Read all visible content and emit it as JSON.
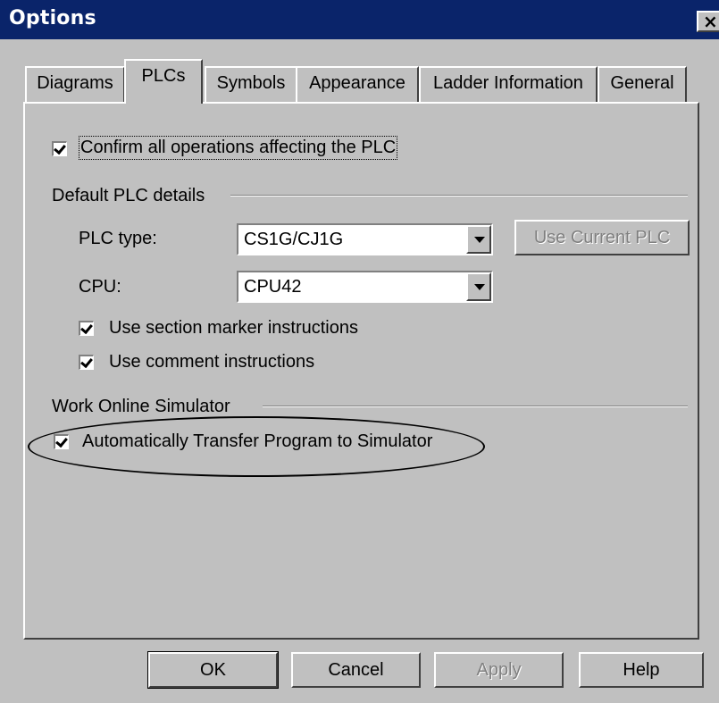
{
  "window": {
    "title": "Options",
    "close_glyph": "×"
  },
  "tabs": [
    {
      "label": "Diagrams"
    },
    {
      "label": "PLCs"
    },
    {
      "label": "Symbols"
    },
    {
      "label": "Appearance"
    },
    {
      "label": "Ladder Information"
    },
    {
      "label": "General"
    }
  ],
  "plcs_tab": {
    "confirm_operations": {
      "label": "Confirm all operations affecting the PLC",
      "checked": true
    },
    "default_plc_details": {
      "group_label": "Default PLC details",
      "plc_type_label": "PLC type:",
      "plc_type_value": "CS1G/CJ1G",
      "use_current_plc_label": "Use Current PLC",
      "cpu_label": "CPU:",
      "cpu_value": "CPU42",
      "use_section_marker": {
        "label": "Use section marker instructions",
        "checked": true
      },
      "use_comment": {
        "label": "Use comment instructions",
        "checked": true
      }
    },
    "work_online_simulator": {
      "group_label": "Work Online Simulator",
      "auto_transfer": {
        "label": "Automatically Transfer Program to Simulator",
        "checked": true
      }
    }
  },
  "buttons": {
    "ok": "OK",
    "cancel": "Cancel",
    "apply": "Apply",
    "help": "Help"
  }
}
